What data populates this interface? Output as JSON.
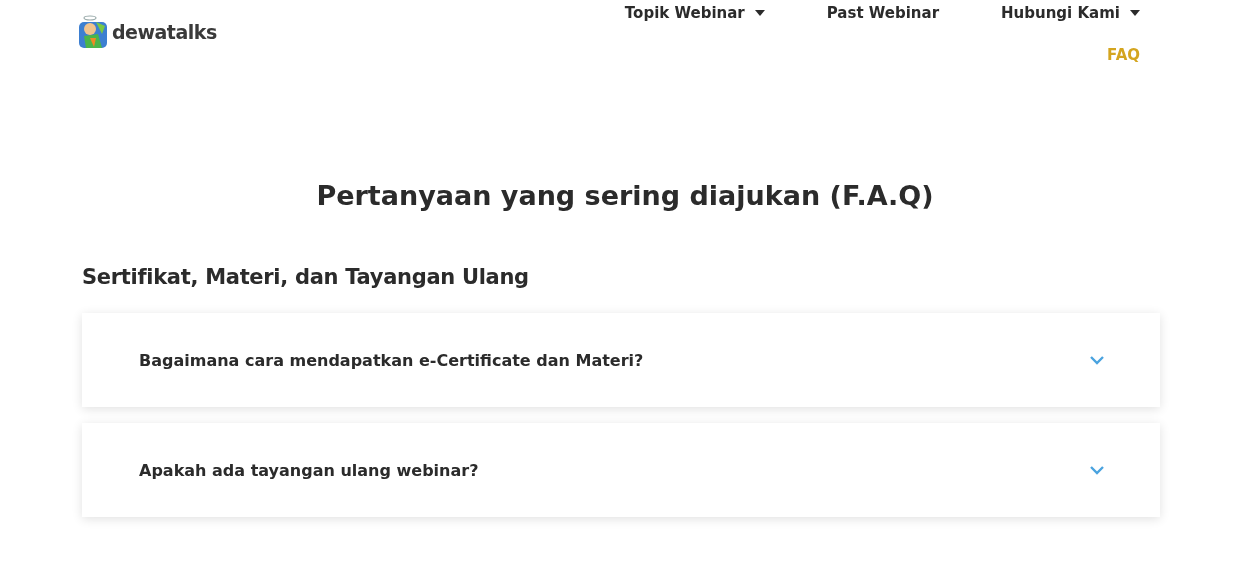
{
  "logo": {
    "text": "dewatalks"
  },
  "nav": [
    {
      "label": "Topik Webinar",
      "dropdown": true,
      "selected": false
    },
    {
      "label": "Past Webinar",
      "dropdown": false,
      "selected": false
    },
    {
      "label": "Hubungi Kami",
      "dropdown": true,
      "selected": false
    },
    {
      "label": "FAQ",
      "dropdown": false,
      "selected": true
    }
  ],
  "title": "Pertanyaan yang sering diajukan (F.A.Q)",
  "section": {
    "heading": "Sertifikat, Materi, dan Tayangan Ulang",
    "questions": [
      {
        "question": "Bagaimana cara mendapatkan e-Certificate dan Materi?",
        "expanded": false
      },
      {
        "question": "Apakah ada tayangan ulang webinar?",
        "expanded": false
      }
    ]
  }
}
